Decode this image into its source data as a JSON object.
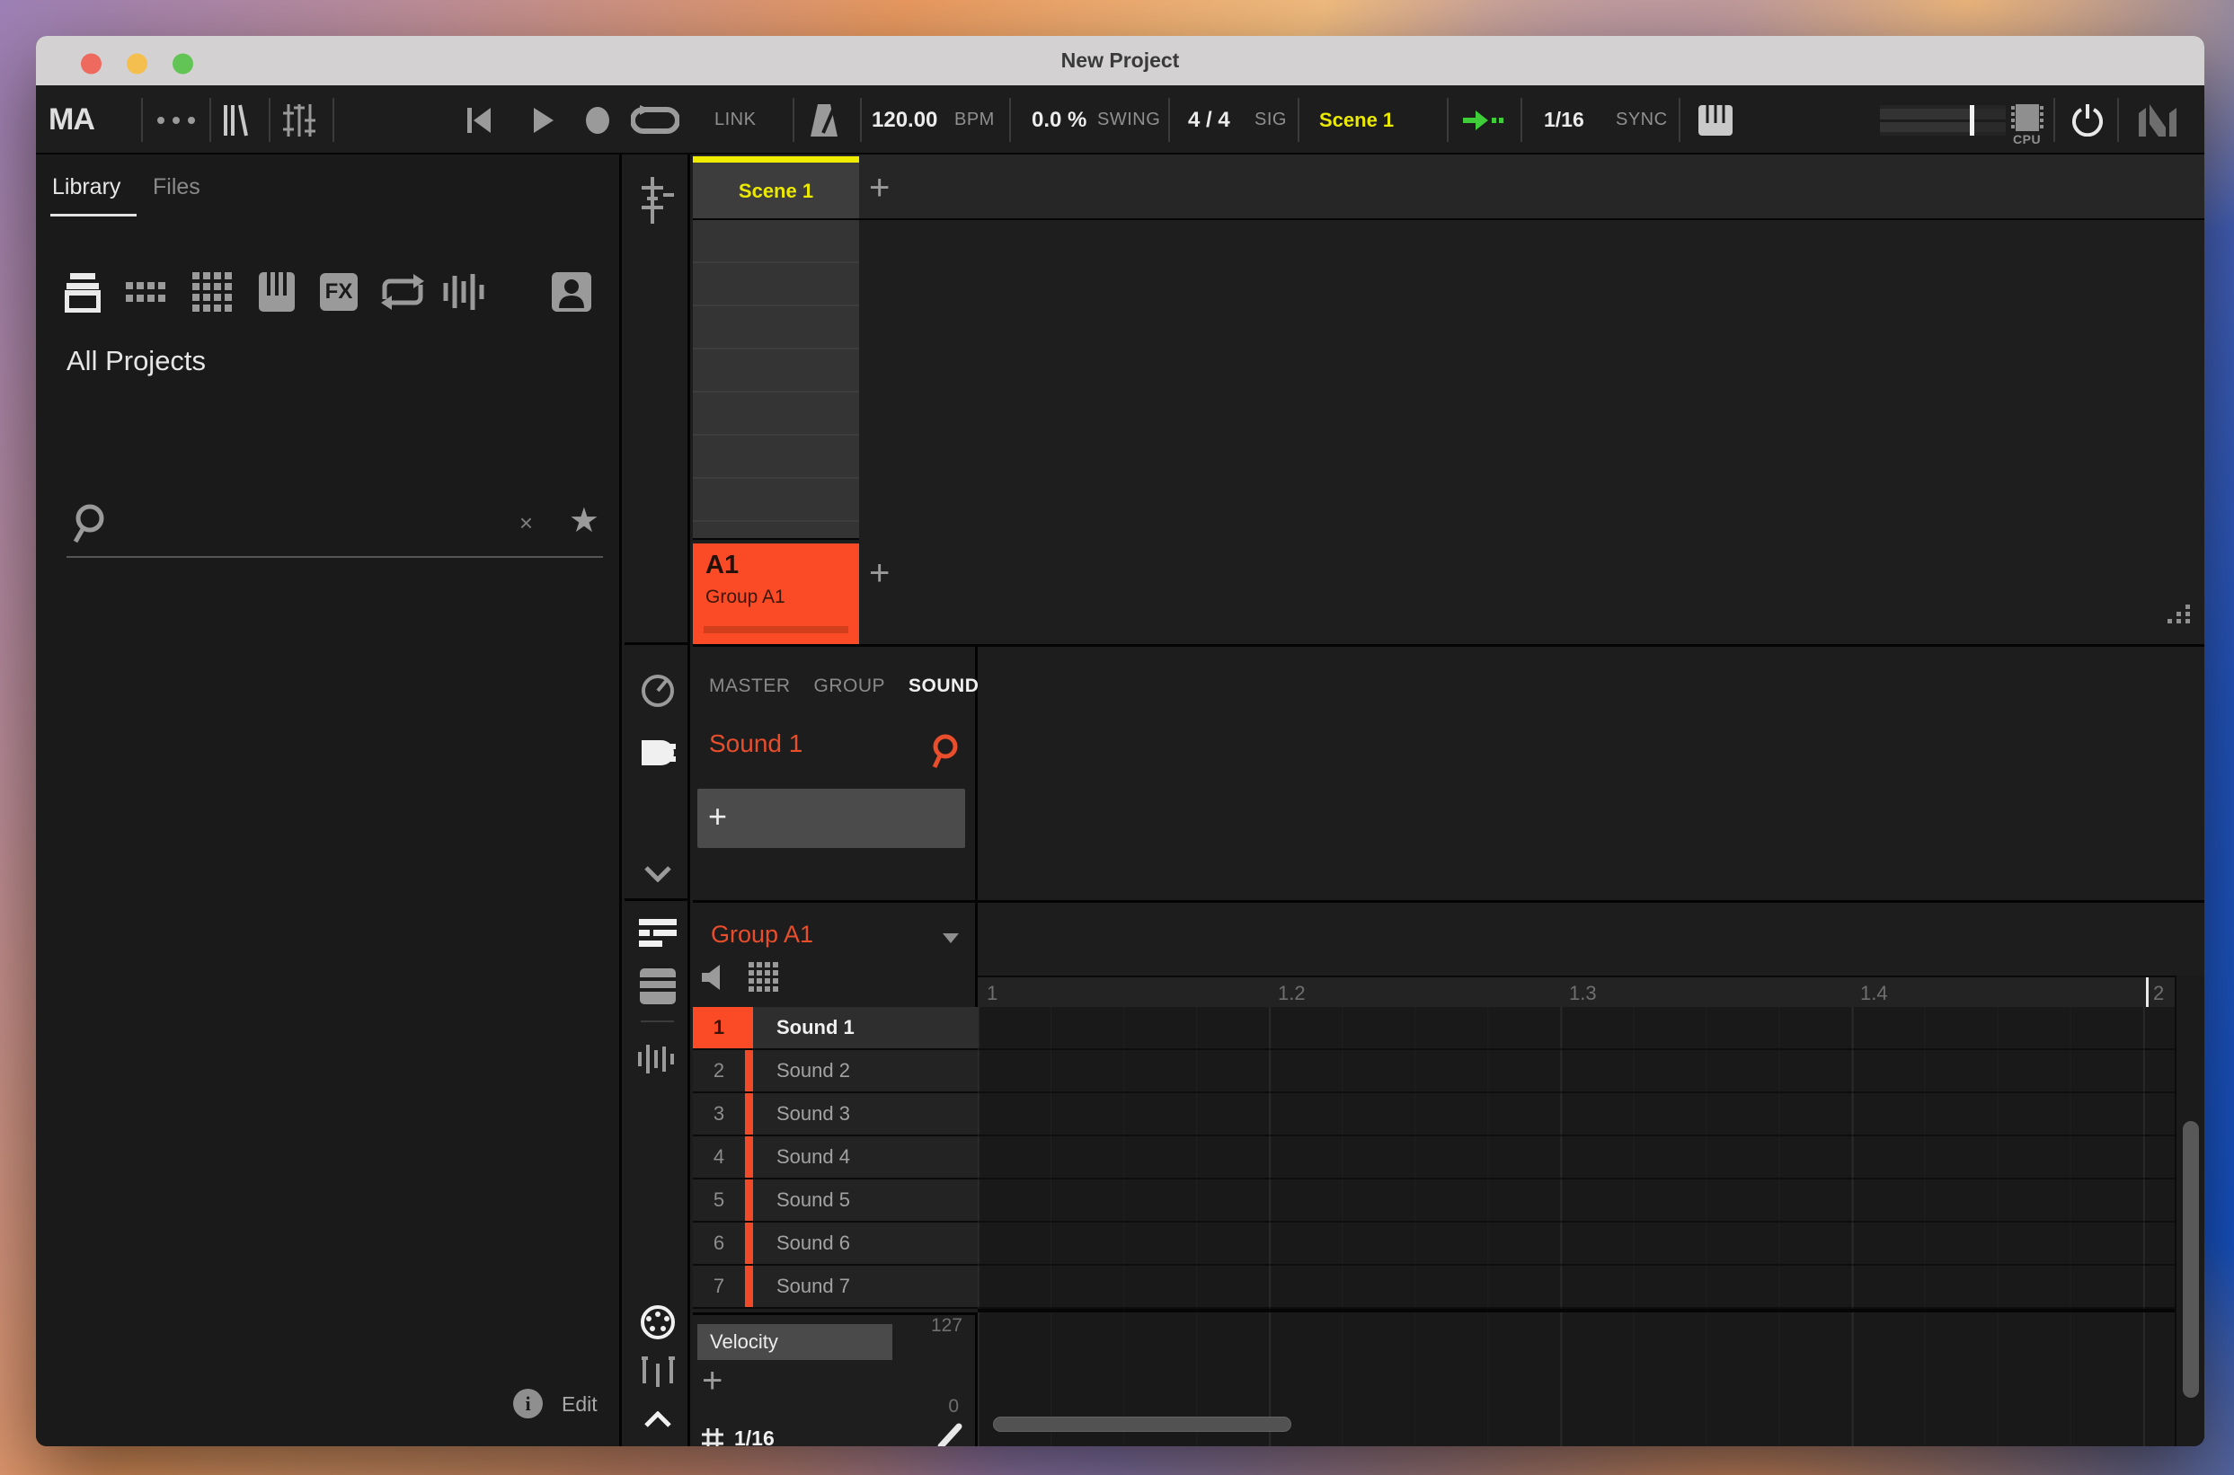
{
  "window": {
    "title": "New Project"
  },
  "toolbar": {
    "logo": "MA",
    "link_label": "LINK",
    "bpm": {
      "value": "120.00",
      "label": "BPM"
    },
    "swing": {
      "value": "0.0 %",
      "label": "SWING"
    },
    "sig": {
      "value": "4 / 4",
      "label": "SIG"
    },
    "scene_label": "Scene 1",
    "sync": {
      "value": "1/16",
      "label": "SYNC"
    },
    "cpu_label": "CPU"
  },
  "browser": {
    "tabs": {
      "library": "Library",
      "files": "Files"
    },
    "effects_label": "FX",
    "heading": "All Projects",
    "search": {
      "value": "",
      "clear_label": "×",
      "favorite_label": "★"
    },
    "footer": {
      "edit_label": "Edit"
    }
  },
  "arranger": {
    "scene_tab_label": "Scene 1",
    "add_scene_label": "+",
    "group": {
      "id": "A1",
      "name": "Group A1"
    },
    "add_group_label": "+"
  },
  "control": {
    "tabs": {
      "master": "MASTER",
      "group": "GROUP",
      "sound": "SOUND"
    },
    "active_tab": "SOUND",
    "sound_name": "Sound 1",
    "slot_add_label": "+"
  },
  "pattern": {
    "group_name": "Group A1",
    "timeline": [
      "1",
      "1.2",
      "1.3",
      "1.4",
      "2"
    ],
    "sounds": [
      {
        "num": "1",
        "name": "Sound 1"
      },
      {
        "num": "2",
        "name": "Sound 2"
      },
      {
        "num": "3",
        "name": "Sound 3"
      },
      {
        "num": "4",
        "name": "Sound 4"
      },
      {
        "num": "5",
        "name": "Sound 5"
      },
      {
        "num": "6",
        "name": "Sound 6"
      },
      {
        "num": "7",
        "name": "Sound 7"
      }
    ],
    "velocity": {
      "label": "Velocity",
      "max_value": "127",
      "min_value": "0",
      "add_label": "+",
      "grid_value": "1/16"
    }
  },
  "colors": {
    "accent_orange": "#fb4b26",
    "accent_yellow": "#ece900",
    "accent_green": "#3fcd3a"
  }
}
